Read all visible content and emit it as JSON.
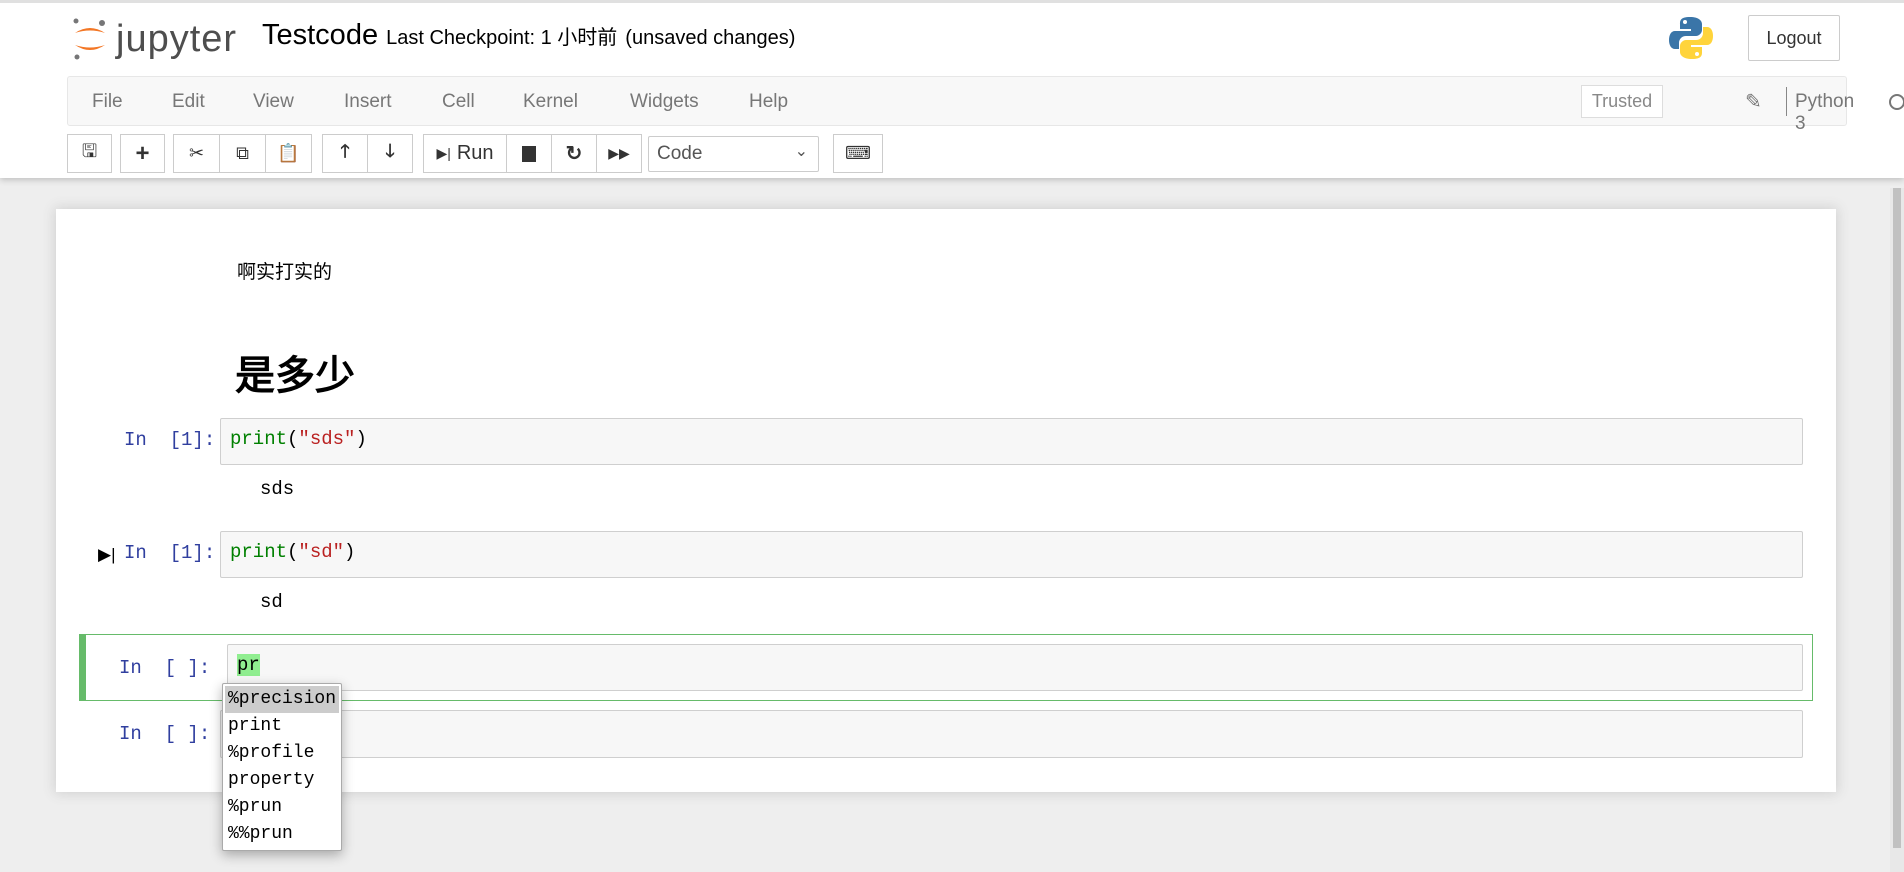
{
  "header": {
    "logo_text": "jupyter",
    "notebook_name": "Testcode",
    "checkpoint": "Last Checkpoint: 1 小时前",
    "unsaved": "(unsaved changes)",
    "logout": "Logout"
  },
  "menu": [
    "File",
    "Edit",
    "View",
    "Insert",
    "Cell",
    "Kernel",
    "Widgets",
    "Help"
  ],
  "status": {
    "trusted": "Trusted",
    "kernel": "Python 3"
  },
  "toolbar": {
    "run": "Run",
    "cell_type": "Code"
  },
  "cells": {
    "md_text": "啊实打实的",
    "md_heading": "是多少",
    "c1": {
      "prompt": "In  [1]:",
      "fn": "print",
      "arg": "\"sds\"",
      "output": "sds"
    },
    "c2": {
      "prompt": "In  [1]:",
      "fn": "print",
      "arg": "\"sd\"",
      "output": "sd"
    },
    "c3": {
      "prompt": "In  [ ]:",
      "code": "pr"
    },
    "c4": {
      "prompt": "In  [ ]:"
    }
  },
  "completer": [
    "%precision",
    "print",
    "%profile",
    "property",
    "%prun",
    "%%prun"
  ]
}
